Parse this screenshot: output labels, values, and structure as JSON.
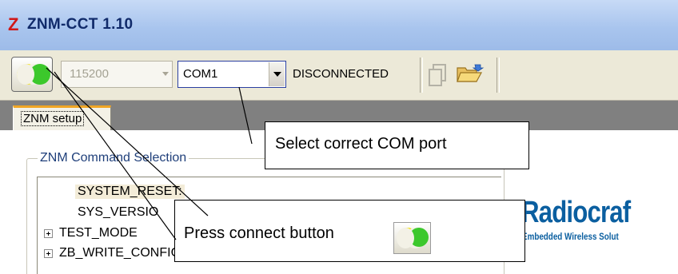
{
  "window": {
    "logo": "Z",
    "title": "ZNM-CCT 1.10"
  },
  "toolbar": {
    "connect_icon": "connect-moon-icon",
    "baud_rate": "115200",
    "com_port": "COM1",
    "status": "DISCONNECTED",
    "icons": [
      "copy-icon",
      "open-folder-icon"
    ]
  },
  "tabs": [
    {
      "label": "ZNM setup",
      "active": true
    }
  ],
  "command_group": {
    "label": "ZNM Command Selection",
    "items": [
      {
        "label": "SYSTEM_RESET:",
        "expandable": false,
        "selected": true
      },
      {
        "label": "SYS_VERSIO",
        "expandable": false,
        "selected": false
      },
      {
        "label": "TEST_MODE",
        "expandable": true,
        "selected": false
      },
      {
        "label": "ZB_WRITE_CONFIGURATION:",
        "expandable": true,
        "selected": false
      }
    ]
  },
  "brand": {
    "name": "Radiocraf",
    "tagline": "Embedded Wireless Solut"
  },
  "callouts": {
    "com_port": "Select correct COM port",
    "connect": "Press connect button"
  },
  "colors": {
    "title_text": "#102a6a",
    "logo": "#d01818",
    "tab_accent": "#f0a524",
    "brand": "#0b5fa0",
    "connect_yellow": "#f2e10a",
    "connect_green": "#3cc82c"
  }
}
